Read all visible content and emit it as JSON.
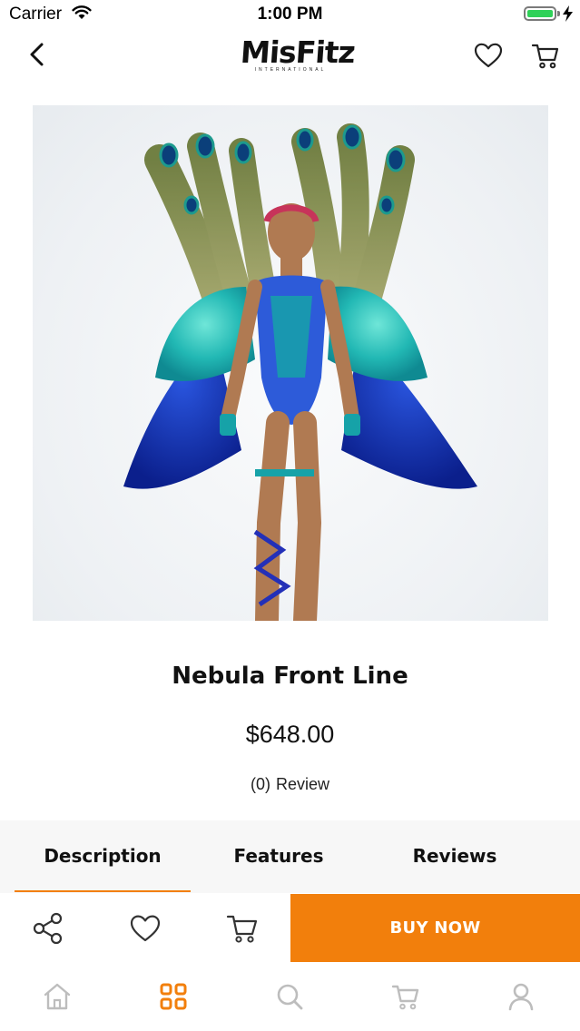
{
  "status_bar": {
    "carrier": "Carrier",
    "time": "1:00 PM",
    "battery_level": 1.0,
    "icons": [
      "wifi-icon",
      "battery-icon",
      "charging-bolt-icon"
    ]
  },
  "nav_bar": {
    "logo_text": "MisFitz",
    "logo_subtext": "INTERNATIONAL",
    "icons": [
      "back-chevron-icon",
      "heart-icon",
      "cart-icon"
    ]
  },
  "product": {
    "title": "Nebula Front Line",
    "price": "$648.00",
    "review_count": "(0)",
    "review_label": "Review"
  },
  "tabs": [
    {
      "label": "Description",
      "active": true
    },
    {
      "label": "Features",
      "active": false
    },
    {
      "label": "Reviews",
      "active": false
    }
  ],
  "action_bar": {
    "buy_now_label": "BUY NOW",
    "icons": [
      "share-icon",
      "heart-icon",
      "cart-icon"
    ]
  },
  "tab_bar": {
    "items": [
      {
        "icon": "home-icon",
        "active": false
      },
      {
        "icon": "grid-icon",
        "active": true
      },
      {
        "icon": "search-icon",
        "active": false
      },
      {
        "icon": "cart-icon",
        "active": false
      },
      {
        "icon": "user-icon",
        "active": false
      }
    ]
  },
  "colors": {
    "accent": "#f27f0c",
    "inactive_icon": "#bdbdbd",
    "tab_background": "#f7f7f7",
    "battery": "#2fd158"
  }
}
